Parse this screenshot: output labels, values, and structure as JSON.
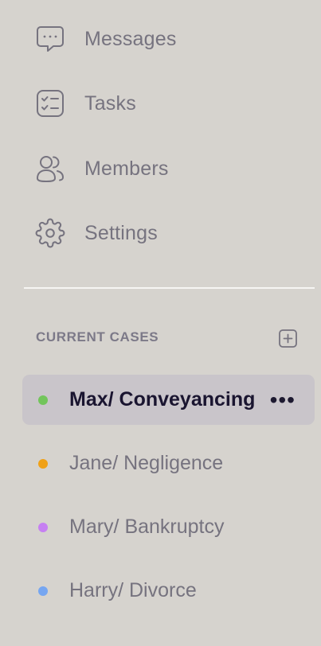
{
  "nav": [
    {
      "label": "Messages",
      "icon": "message-square-icon"
    },
    {
      "label": "Tasks",
      "icon": "checklist-icon"
    },
    {
      "label": "Members",
      "icon": "users-icon"
    },
    {
      "label": "Settings",
      "icon": "gear-icon"
    }
  ],
  "cases": {
    "title": "CURRENT CASES",
    "add_icon": "plus-square-icon",
    "items": [
      {
        "label": "Max/ Conveyancing",
        "color": "#72c55b",
        "active": true,
        "more": "•••"
      },
      {
        "label": "Jane/ Negligence",
        "color": "#f0a117"
      },
      {
        "label": "Mary/ Bankruptcy",
        "color": "#c680f2"
      },
      {
        "label": "Harry/ Divorce",
        "color": "#76a6f1"
      }
    ]
  },
  "colors": {
    "background": "#d6d3ce",
    "active_bg": "#c9c5ca",
    "text_muted": "#76737f",
    "text_active": "#1a1530",
    "divider": "#f6f5f3"
  }
}
